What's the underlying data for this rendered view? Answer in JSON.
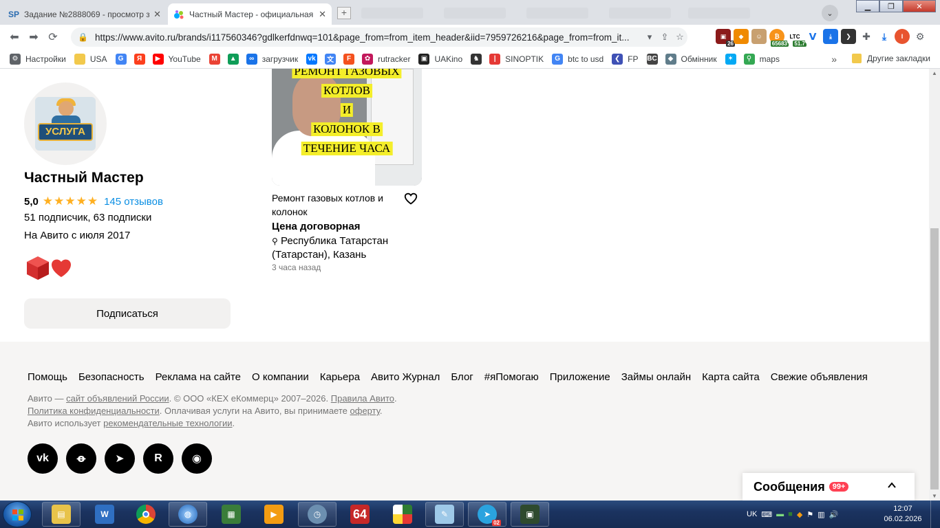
{
  "browser": {
    "tabs": [
      {
        "favicon": "SP",
        "title": "Задание №2888069 - просмотр з",
        "active": false
      },
      {
        "favicon": "avito-logo-icon",
        "title": "Частный Мастер - официальная с",
        "active": true
      }
    ],
    "url": "https://www.avito.ru/brands/i117560346?gdlkerfdnwq=101&page_from=from_item_header&iid=7959726216&page_from=from_it...",
    "extension_badges": {
      "shield": "26",
      "price": "65683",
      "ltc_label": "LTC",
      "ltc_value": "51.7",
      "profile": "I"
    },
    "bookmarks": [
      {
        "label": "Настройки",
        "icon": "gear-icon"
      },
      {
        "label": "USA",
        "icon": "folder-icon"
      },
      {
        "label": "",
        "icon": "google-icon"
      },
      {
        "label": "",
        "icon": "yandex-icon"
      },
      {
        "label": "YouTube",
        "icon": "youtube-icon"
      },
      {
        "label": "",
        "icon": "gmail-icon"
      },
      {
        "label": "",
        "icon": "drive-icon"
      },
      {
        "label": "загрузчик",
        "icon": "loader-icon"
      },
      {
        "label": "",
        "icon": "vk-icon"
      },
      {
        "label": "",
        "icon": "translate-icon"
      },
      {
        "label": "",
        "icon": "f-icon"
      },
      {
        "label": "rutracker",
        "icon": "rutracker-icon"
      },
      {
        "label": "UAKino",
        "icon": "uakino-icon"
      },
      {
        "label": "",
        "icon": "chess-icon"
      },
      {
        "label": "SINOPTIK",
        "icon": "thermometer-icon"
      },
      {
        "label": "btc to usd",
        "icon": "google-icon"
      },
      {
        "label": "FP",
        "icon": "fp-icon"
      },
      {
        "label": "",
        "icon": "bc-icon"
      },
      {
        "label": "Обмінник",
        "icon": "exchange-icon"
      },
      {
        "label": "",
        "icon": "star-icon"
      },
      {
        "label": "maps",
        "icon": "maps-icon"
      }
    ],
    "bookmarks_more": "»",
    "other_bookmarks": "Другие закладки"
  },
  "seller": {
    "name": "Частный Мастер",
    "logo_text": "УСЛУГА",
    "rating": "5,0",
    "stars": 5,
    "reviews_link": "145 отзывов",
    "subscribers": "51 подписчик, 63 подписки",
    "since": "На Авито с июля 2017",
    "subscribe_button": "Подписаться"
  },
  "listing": {
    "image_caption": [
      "РЕМОНТ ГАЗОВЫХ",
      "КОТЛОВ",
      "И",
      "КОЛОНОК В",
      "ТЕЧЕНИЕ ЧАСА"
    ],
    "title": "Ремонт газовых котлов и колонок",
    "price": "Цена договорная",
    "location": "Республика Татарстан (Татарстан), Казань",
    "posted": "3 часа назад"
  },
  "footer": {
    "links": [
      "Помощь",
      "Безопасность",
      "Реклама на сайте",
      "О компании",
      "Карьера",
      "Авито Журнал",
      "Блог",
      "#яПомогаю",
      "Приложение",
      "Займы онлайн",
      "Карта сайта",
      "Свежие объявления"
    ],
    "legal": {
      "l1_a": "Авито — ",
      "l1_link1": "сайт объявлений России",
      "l1_b": ". © ООО «КЕХ еКоммерц» 2007–2026. ",
      "l1_link2": "Правила Авито",
      "l1_c": ".",
      "l2_link1": "Политика конфиденциальности",
      "l2_a": ". Оплачивая услуги на Авито, вы принимаете ",
      "l2_link2": "оферту",
      "l2_b": ".",
      "l3_a": "Авито использует ",
      "l3_link": "рекомендательные технологии",
      "l3_b": "."
    },
    "socials": [
      "vk-icon",
      "odnoklassniki-icon",
      "telegram-icon",
      "rutube-icon",
      "dzen-icon"
    ]
  },
  "messages": {
    "label": "Сообщения",
    "count": "99+"
  },
  "taskbar": {
    "telegram_badge": "02",
    "app_64_label": "64",
    "tray_lang": "UK",
    "time": "12:07",
    "date": "06.02.2026"
  },
  "colors": {
    "link": "#0a8ee3",
    "star": "#ffb021",
    "badge": "#ff4053",
    "footer_bg": "#f6f5f4"
  }
}
